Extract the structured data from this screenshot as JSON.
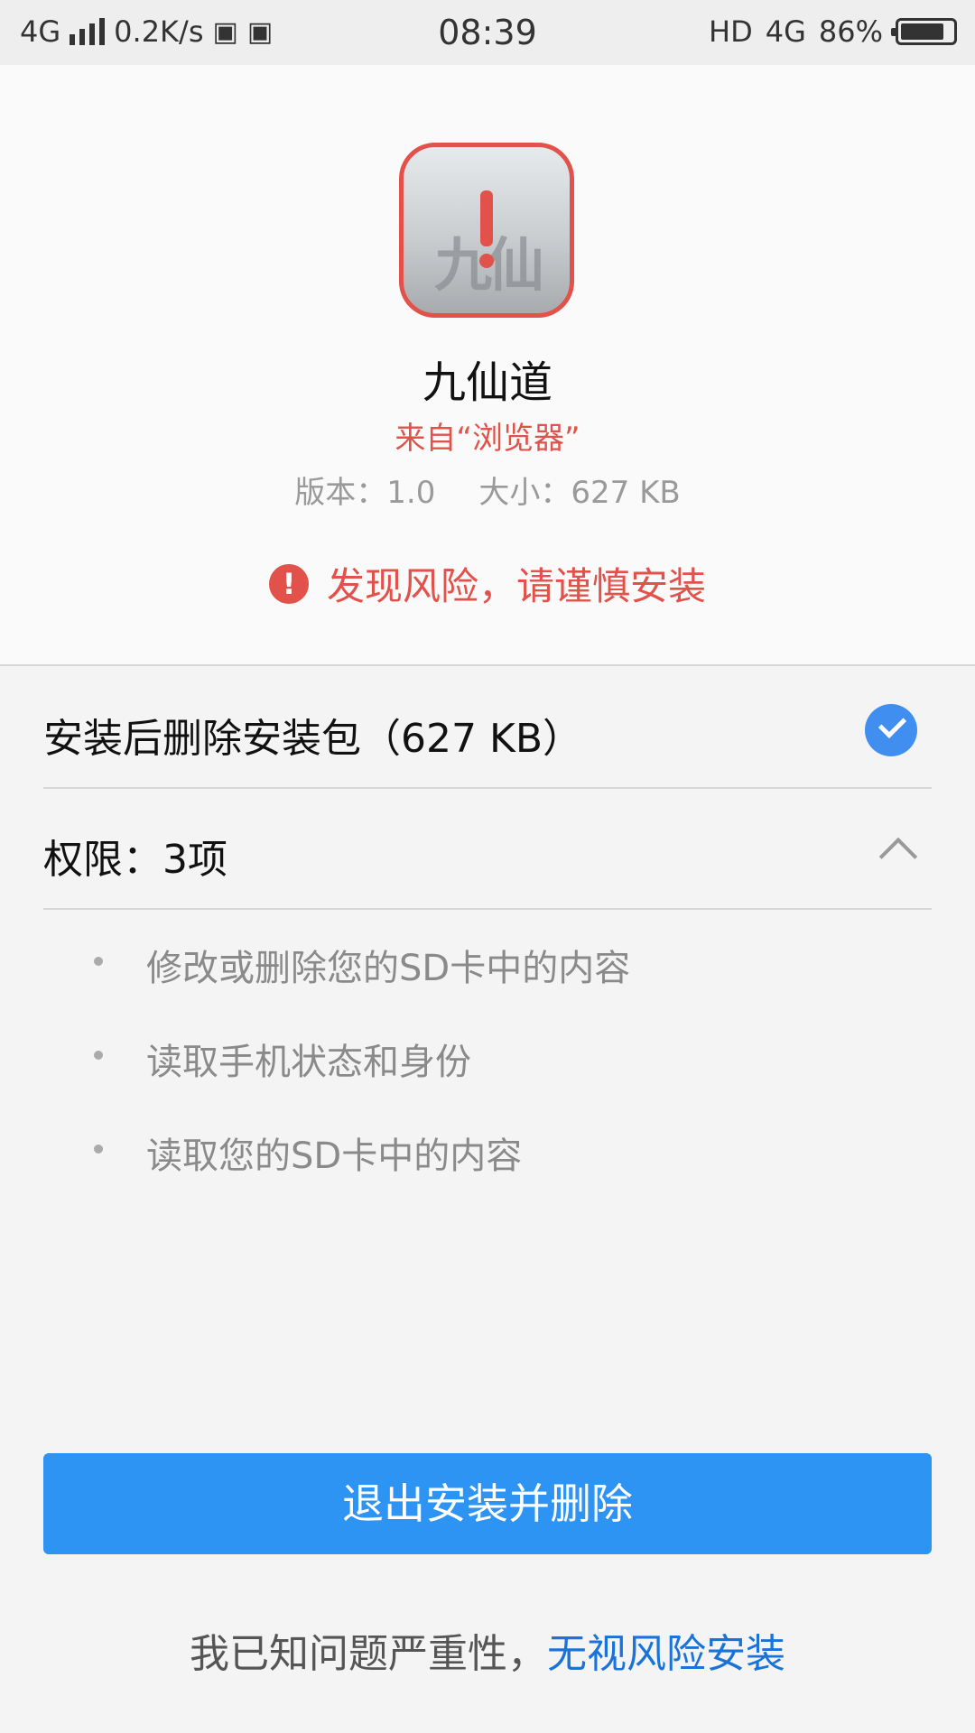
{
  "status_bar": {
    "network": "4G",
    "speed": "0.2K/s",
    "time": "08:39",
    "hd": "HD",
    "network_right": "4G",
    "battery_percent": "86%",
    "battery_level": 0.86
  },
  "app": {
    "name": "九仙道",
    "source": "来自“浏览器”",
    "version": "版本：1.0",
    "size": "大小：627 KB",
    "risk_warning": "发现风险，请谨慎安装",
    "icon_name": "app-warning-icon"
  },
  "options": {
    "delete_package_label": "安装后删除安装包（627 KB）",
    "delete_package_checked": true,
    "permissions_label": "权限：3项"
  },
  "permissions": [
    "修改或删除您的SD卡中的内容",
    "读取手机状态和身份",
    "读取您的SD卡中的内容"
  ],
  "actions": {
    "exit_and_delete": "退出安装并删除",
    "ignore_prefix": "我已知问题严重性，",
    "ignore_link": "无视风险安装"
  },
  "colors": {
    "accent_blue": "#2d94f3",
    "risk_red": "#e2514a",
    "link_blue": "#1a73d8"
  }
}
